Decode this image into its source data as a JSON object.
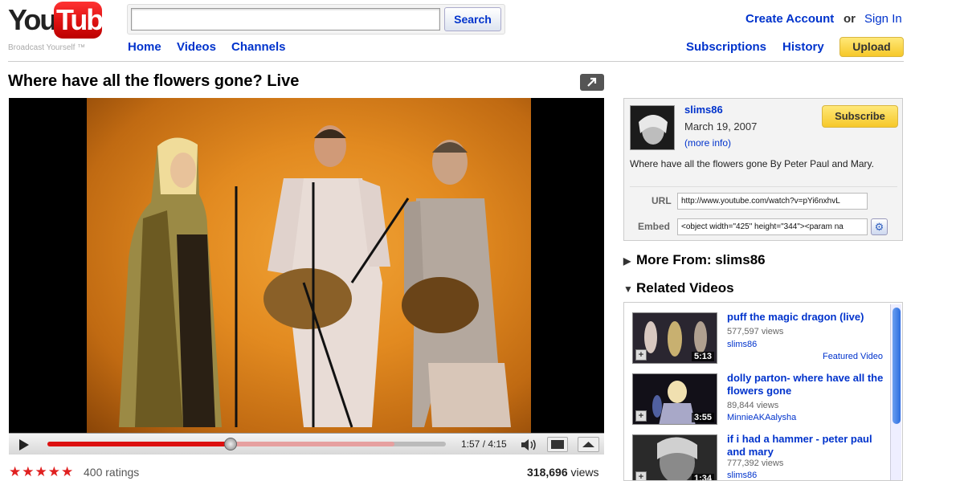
{
  "header": {
    "logo_you": "You",
    "logo_tube": "Tube",
    "logo_tagline": "Broadcast Yourself ™",
    "search": {
      "value": "",
      "button_label": "Search"
    },
    "nav": [
      "Home",
      "Videos",
      "Channels"
    ],
    "create_account": "Create Account",
    "or": "or",
    "sign_in": "Sign In",
    "subscriptions": "Subscriptions",
    "history": "History",
    "upload": "Upload"
  },
  "video": {
    "title": "Where have all the flowers gone? Live",
    "current_time": "1:57",
    "duration": "4:15",
    "time_display": "1:57 / 4:15",
    "progress": 0.46,
    "buffered": 0.87,
    "rating_stars": "★★★★★",
    "ratings": "400 ratings",
    "views_number": "318,696",
    "views_label": "views"
  },
  "channel": {
    "name": "slims86",
    "date": "March 19, 2007",
    "more_info": "(more info)",
    "subscribe": "Subscribe",
    "description": "Where have all the flowers gone By Peter Paul and Mary.",
    "url_label": "URL",
    "url_value": "http://www.youtube.com/watch?v=pYi6nxhvL",
    "embed_label": "Embed",
    "embed_value": "<object width=\"425\" height=\"344\"><param na"
  },
  "sections": {
    "more_from": "More From: slims86",
    "related": "Related Videos"
  },
  "related_videos": [
    {
      "title": "puff the magic dragon (live)",
      "views": "577,597 views",
      "user": "slims86",
      "duration": "5:13",
      "featured": "Featured Video"
    },
    {
      "title": "dolly parton- where have all the flowers gone",
      "views": "89,844 views",
      "user": "MinnieAKAalysha",
      "duration": "3:55"
    },
    {
      "title": "if i had a hammer - peter paul and mary",
      "views": "777,392 views",
      "user": "slims86",
      "duration": "1:34"
    }
  ],
  "colors": {
    "link": "#0033cc",
    "progress_played": "#dd1111",
    "button_yellow": "#f6c829",
    "stage_orange": "#e28a20"
  },
  "icons": {
    "share": "share-arrow-icon",
    "play": "play-icon",
    "volume": "volume-icon",
    "settings": "gear-icon"
  }
}
